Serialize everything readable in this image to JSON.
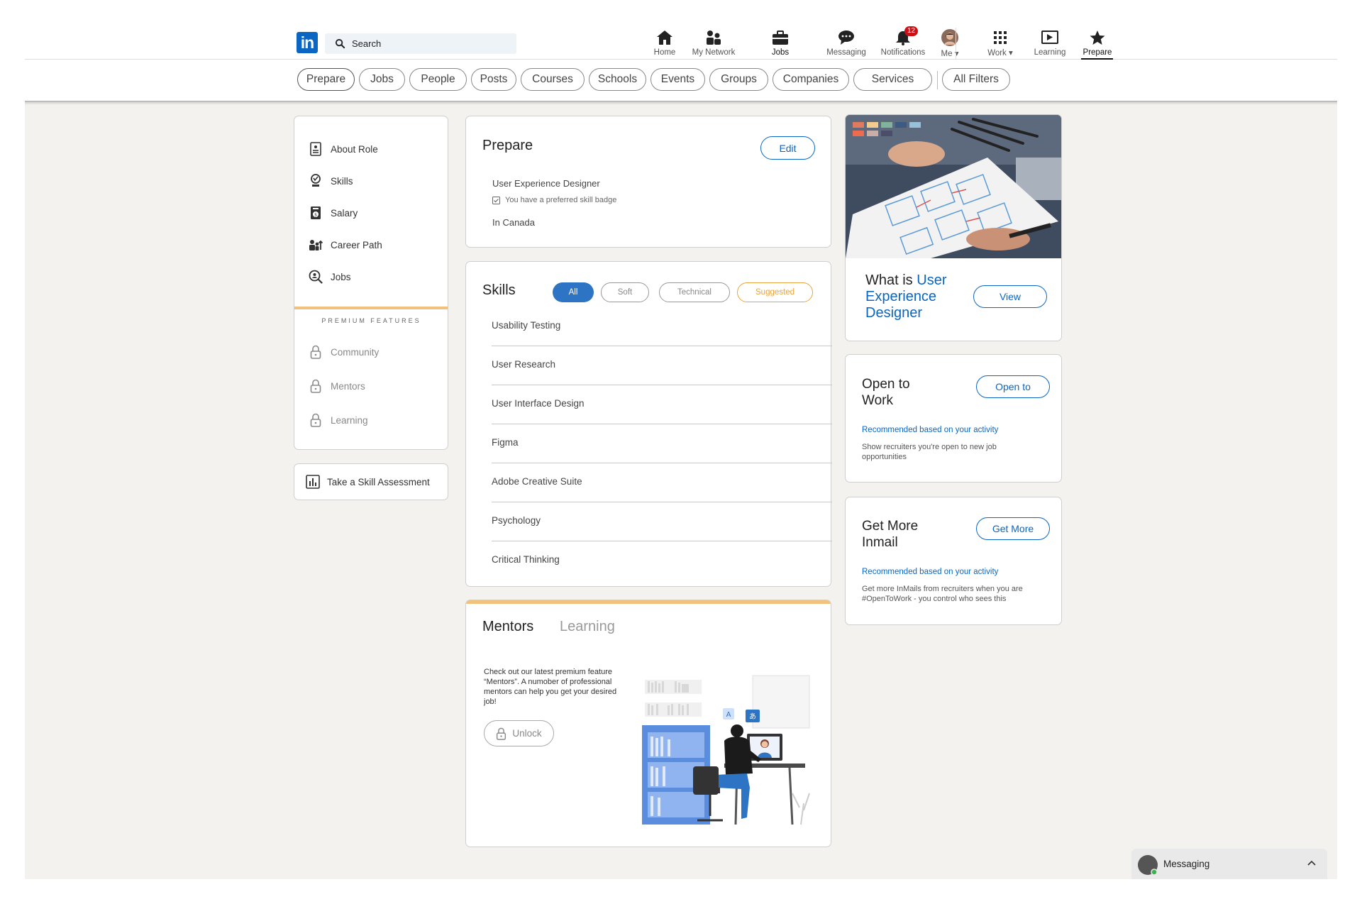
{
  "search": {
    "label": "Search"
  },
  "nav": {
    "home": "Home",
    "network": "My Network",
    "jobs": "Jobs",
    "messaging": "Messaging",
    "notifications": "Notifications",
    "notifications_count": "12",
    "me": "Me",
    "work": "Work",
    "learning": "Learning",
    "prepare": "Prepare"
  },
  "filters": [
    "Prepare",
    "Jobs",
    "People",
    "Posts",
    "Courses",
    "Schools",
    "Events",
    "Groups",
    "Companies",
    "Services",
    "All Filters"
  ],
  "sidebar": {
    "items": [
      "About Role",
      "Skills",
      "Salary",
      "Career Path",
      "Jobs"
    ],
    "premium_label": "PREMIUM FEATURES",
    "locked_items": [
      "Community",
      "Mentors",
      "Learning"
    ],
    "assessment": "Take a Skill Assessment"
  },
  "prepare_card": {
    "title": "Prepare",
    "edit": "Edit",
    "role": "User Experience Designer",
    "badge_note": "You have a preferred skill badge",
    "location": "In Canada"
  },
  "skills_card": {
    "title": "Skills",
    "chips": [
      "All",
      "Soft",
      "Technical",
      "Suggested"
    ],
    "skills": [
      "Usability Testing",
      "User Research",
      "User Interface Design",
      "Figma",
      "Adobe Creative Suite",
      "Psychology",
      "Critical Thinking"
    ]
  },
  "mentors_card": {
    "tab_mentors": "Mentors",
    "tab_learning": "Learning",
    "text": "Check out our latest premium feature “Mentors”. A numober of professional mentors can help you get your desired job!",
    "unlock": "Unlock"
  },
  "role_card": {
    "prefix": "What is ",
    "role_line1": "User",
    "role_line2": "Experience",
    "role_line3": "Designer",
    "view": "View"
  },
  "open_card": {
    "title_l1": "Open to",
    "title_l2": "Work",
    "button": "Open to",
    "rec": "Recommended based on your activity",
    "desc": "Show recruiters you're open to new job opportunities"
  },
  "inmail_card": {
    "title_l1": "Get More",
    "title_l2": "Inmail",
    "button": "Get More",
    "rec": "Recommended based on your activity",
    "desc": "Get more InMails from recruiters when you are #OpenToWork -  you control who sees this"
  },
  "messaging_bar": {
    "label": "Messaging"
  },
  "colors": {
    "brand": "#0a66c2",
    "premium": "#f0c27b",
    "suggested": "#e8a33d",
    "badge": "#cc1016"
  }
}
